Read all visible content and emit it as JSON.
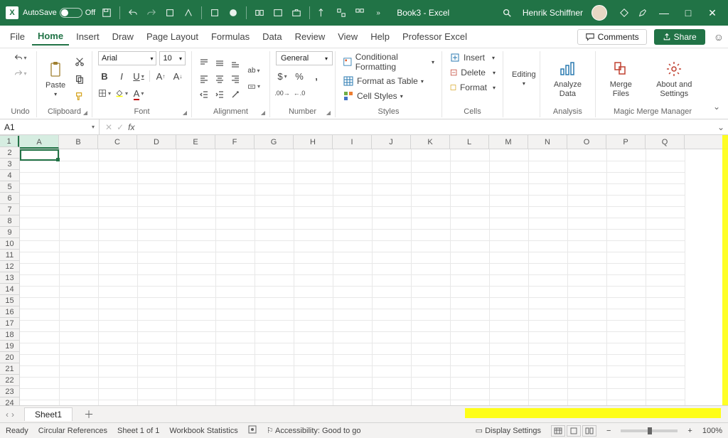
{
  "titlebar": {
    "autosave_label": "AutoSave",
    "autosave_state": "Off",
    "doc_title": "Book3  -  Excel",
    "username": "Henrik Schiffner"
  },
  "menus": {
    "file": "File",
    "home": "Home",
    "insert": "Insert",
    "draw": "Draw",
    "page_layout": "Page Layout",
    "formulas": "Formulas",
    "data": "Data",
    "review": "Review",
    "view": "View",
    "help": "Help",
    "professor": "Professor Excel",
    "comments": "Comments",
    "share": "Share"
  },
  "ribbon": {
    "undo": "Undo",
    "paste": "Paste",
    "clipboard": "Clipboard",
    "font_name": "Arial",
    "font_size": "10",
    "font": "Font",
    "alignment": "Alignment",
    "number_format": "General",
    "number": "Number",
    "cond_format": "Conditional Formatting",
    "format_table": "Format as Table",
    "cell_styles": "Cell Styles",
    "styles": "Styles",
    "insert_cells": "Insert",
    "delete_cells": "Delete",
    "format_cells": "Format",
    "cells": "Cells",
    "editing": "Editing",
    "analyze": "Analyze Data",
    "analysis": "Analysis",
    "merge_files": "Merge Files",
    "about_settings": "About and Settings",
    "magic_merge": "Magic Merge Manager"
  },
  "namebox": {
    "ref": "A1",
    "fx": "fx"
  },
  "columns": [
    "A",
    "B",
    "C",
    "D",
    "E",
    "F",
    "G",
    "H",
    "I",
    "J",
    "K",
    "L",
    "M",
    "N",
    "O",
    "P",
    "Q"
  ],
  "rows": [
    "1",
    "2",
    "3",
    "4",
    "5",
    "6",
    "7",
    "8",
    "9",
    "10",
    "11",
    "12",
    "13",
    "14",
    "15",
    "16",
    "17",
    "18",
    "19",
    "20",
    "21",
    "22",
    "23",
    "24"
  ],
  "sheet": {
    "name": "Sheet1"
  },
  "status": {
    "ready": "Ready",
    "circ": "Circular References",
    "sheet_count": "Sheet 1 of 1",
    "wb_stats": "Workbook Statistics",
    "accessibility": "Accessibility: Good to go",
    "display": "Display Settings",
    "zoom": "100%"
  }
}
